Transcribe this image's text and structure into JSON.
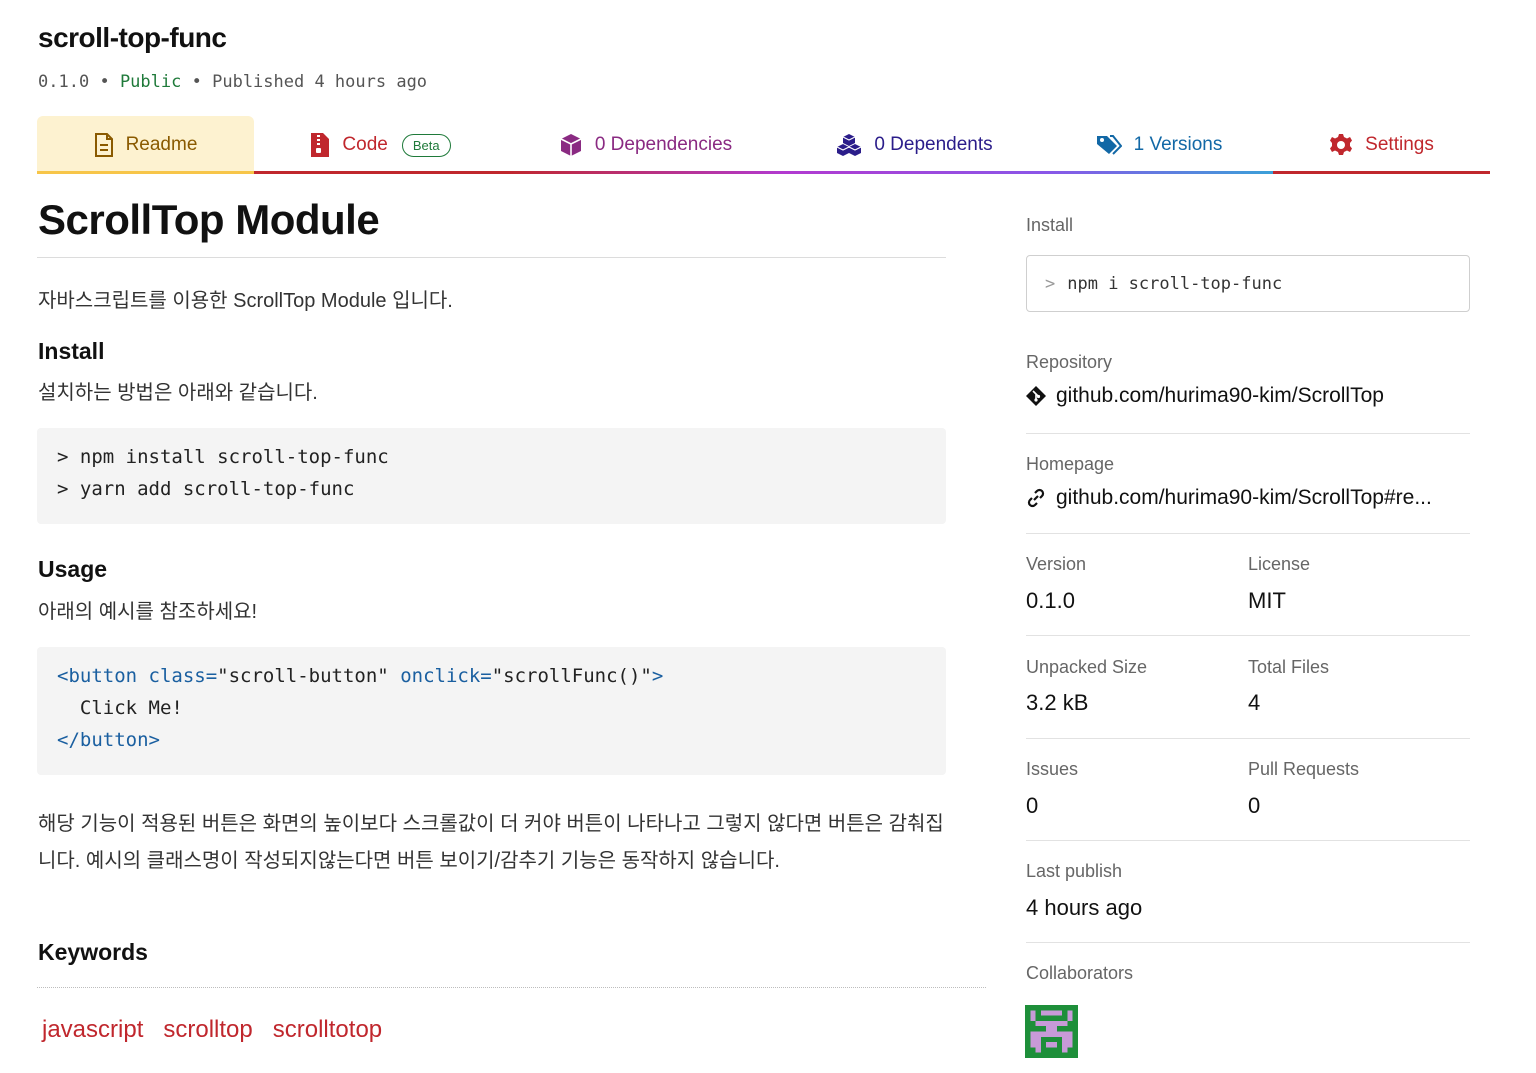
{
  "package": {
    "name": "scroll-top-func",
    "version": "0.1.0",
    "visibility": "Public",
    "published": "Published 4 hours ago",
    "separator": "•"
  },
  "tabs": [
    {
      "label": "Readme",
      "icon": "readme-icon"
    },
    {
      "label": "Code",
      "icon": "code-icon",
      "badge": "Beta"
    },
    {
      "label": "0 Dependencies",
      "icon": "box-icon"
    },
    {
      "label": "0 Dependents",
      "icon": "boxes-icon"
    },
    {
      "label": "1 Versions",
      "icon": "tags-icon"
    },
    {
      "label": "Settings",
      "icon": "gear-icon"
    }
  ],
  "readme": {
    "title": "ScrollTop Module",
    "intro": "자바스크립트를 이용한 ScrollTop Module 입니다.",
    "install_heading": "Install",
    "install_text": "설치하는 방법은 아래와 같습니다.",
    "install_code": [
      "> npm install scroll-top-func",
      "> yarn add scroll-top-func"
    ],
    "usage_heading": "Usage",
    "usage_text": "아래의 예시를 참조하세요!",
    "usage_code": {
      "open_tag": "<button",
      "attr1": " class=",
      "val1": "\"scroll-button\"",
      "attr2": " onclick=",
      "val2": "\"scrollFunc()\"",
      "open_end": ">",
      "inner": "  Click Me!",
      "close_tag": "</button>"
    },
    "description": "해당 기능이 적용된 버튼은 화면의 높이보다 스크롤값이 더 커야 버튼이 나타나고 그렇지 않다면 버튼은 감춰집니다. 예시의 클래스명이 작성되지않는다면 버튼 보이기/감추기 기능은 동작하지 않습니다.",
    "keywords_heading": "Keywords",
    "keywords": [
      "javascript",
      "scrolltop",
      "scrolltotop"
    ]
  },
  "sidebar": {
    "install_label": "Install",
    "install_prompt": ">",
    "install_command": "npm i scroll-top-func",
    "repository_label": "Repository",
    "repository_url": "github.com/hurima90-kim/ScrollTop",
    "homepage_label": "Homepage",
    "homepage_url": "github.com/hurima90-kim/ScrollTop#re...",
    "version_label": "Version",
    "version": "0.1.0",
    "license_label": "License",
    "license": "MIT",
    "unpacked_label": "Unpacked Size",
    "unpacked": "3.2 kB",
    "files_label": "Total Files",
    "files": "4",
    "issues_label": "Issues",
    "issues": "0",
    "prs_label": "Pull Requests",
    "prs": "0",
    "last_publish_label": "Last publish",
    "last_publish": "4 hours ago",
    "collaborators_label": "Collaborators"
  },
  "colors": {
    "tab_bar_readme": "#f7c548",
    "tab_bar_code": "#c0272d",
    "tab_bar_deps": "#b23ad0",
    "tab_bar_dependents": "#8a56e8",
    "tab_bar_versions": "#3aa0d8",
    "tab_bar_settings": "#c0272d",
    "keyword": "#c0272d",
    "public": "#1f7a3a"
  }
}
